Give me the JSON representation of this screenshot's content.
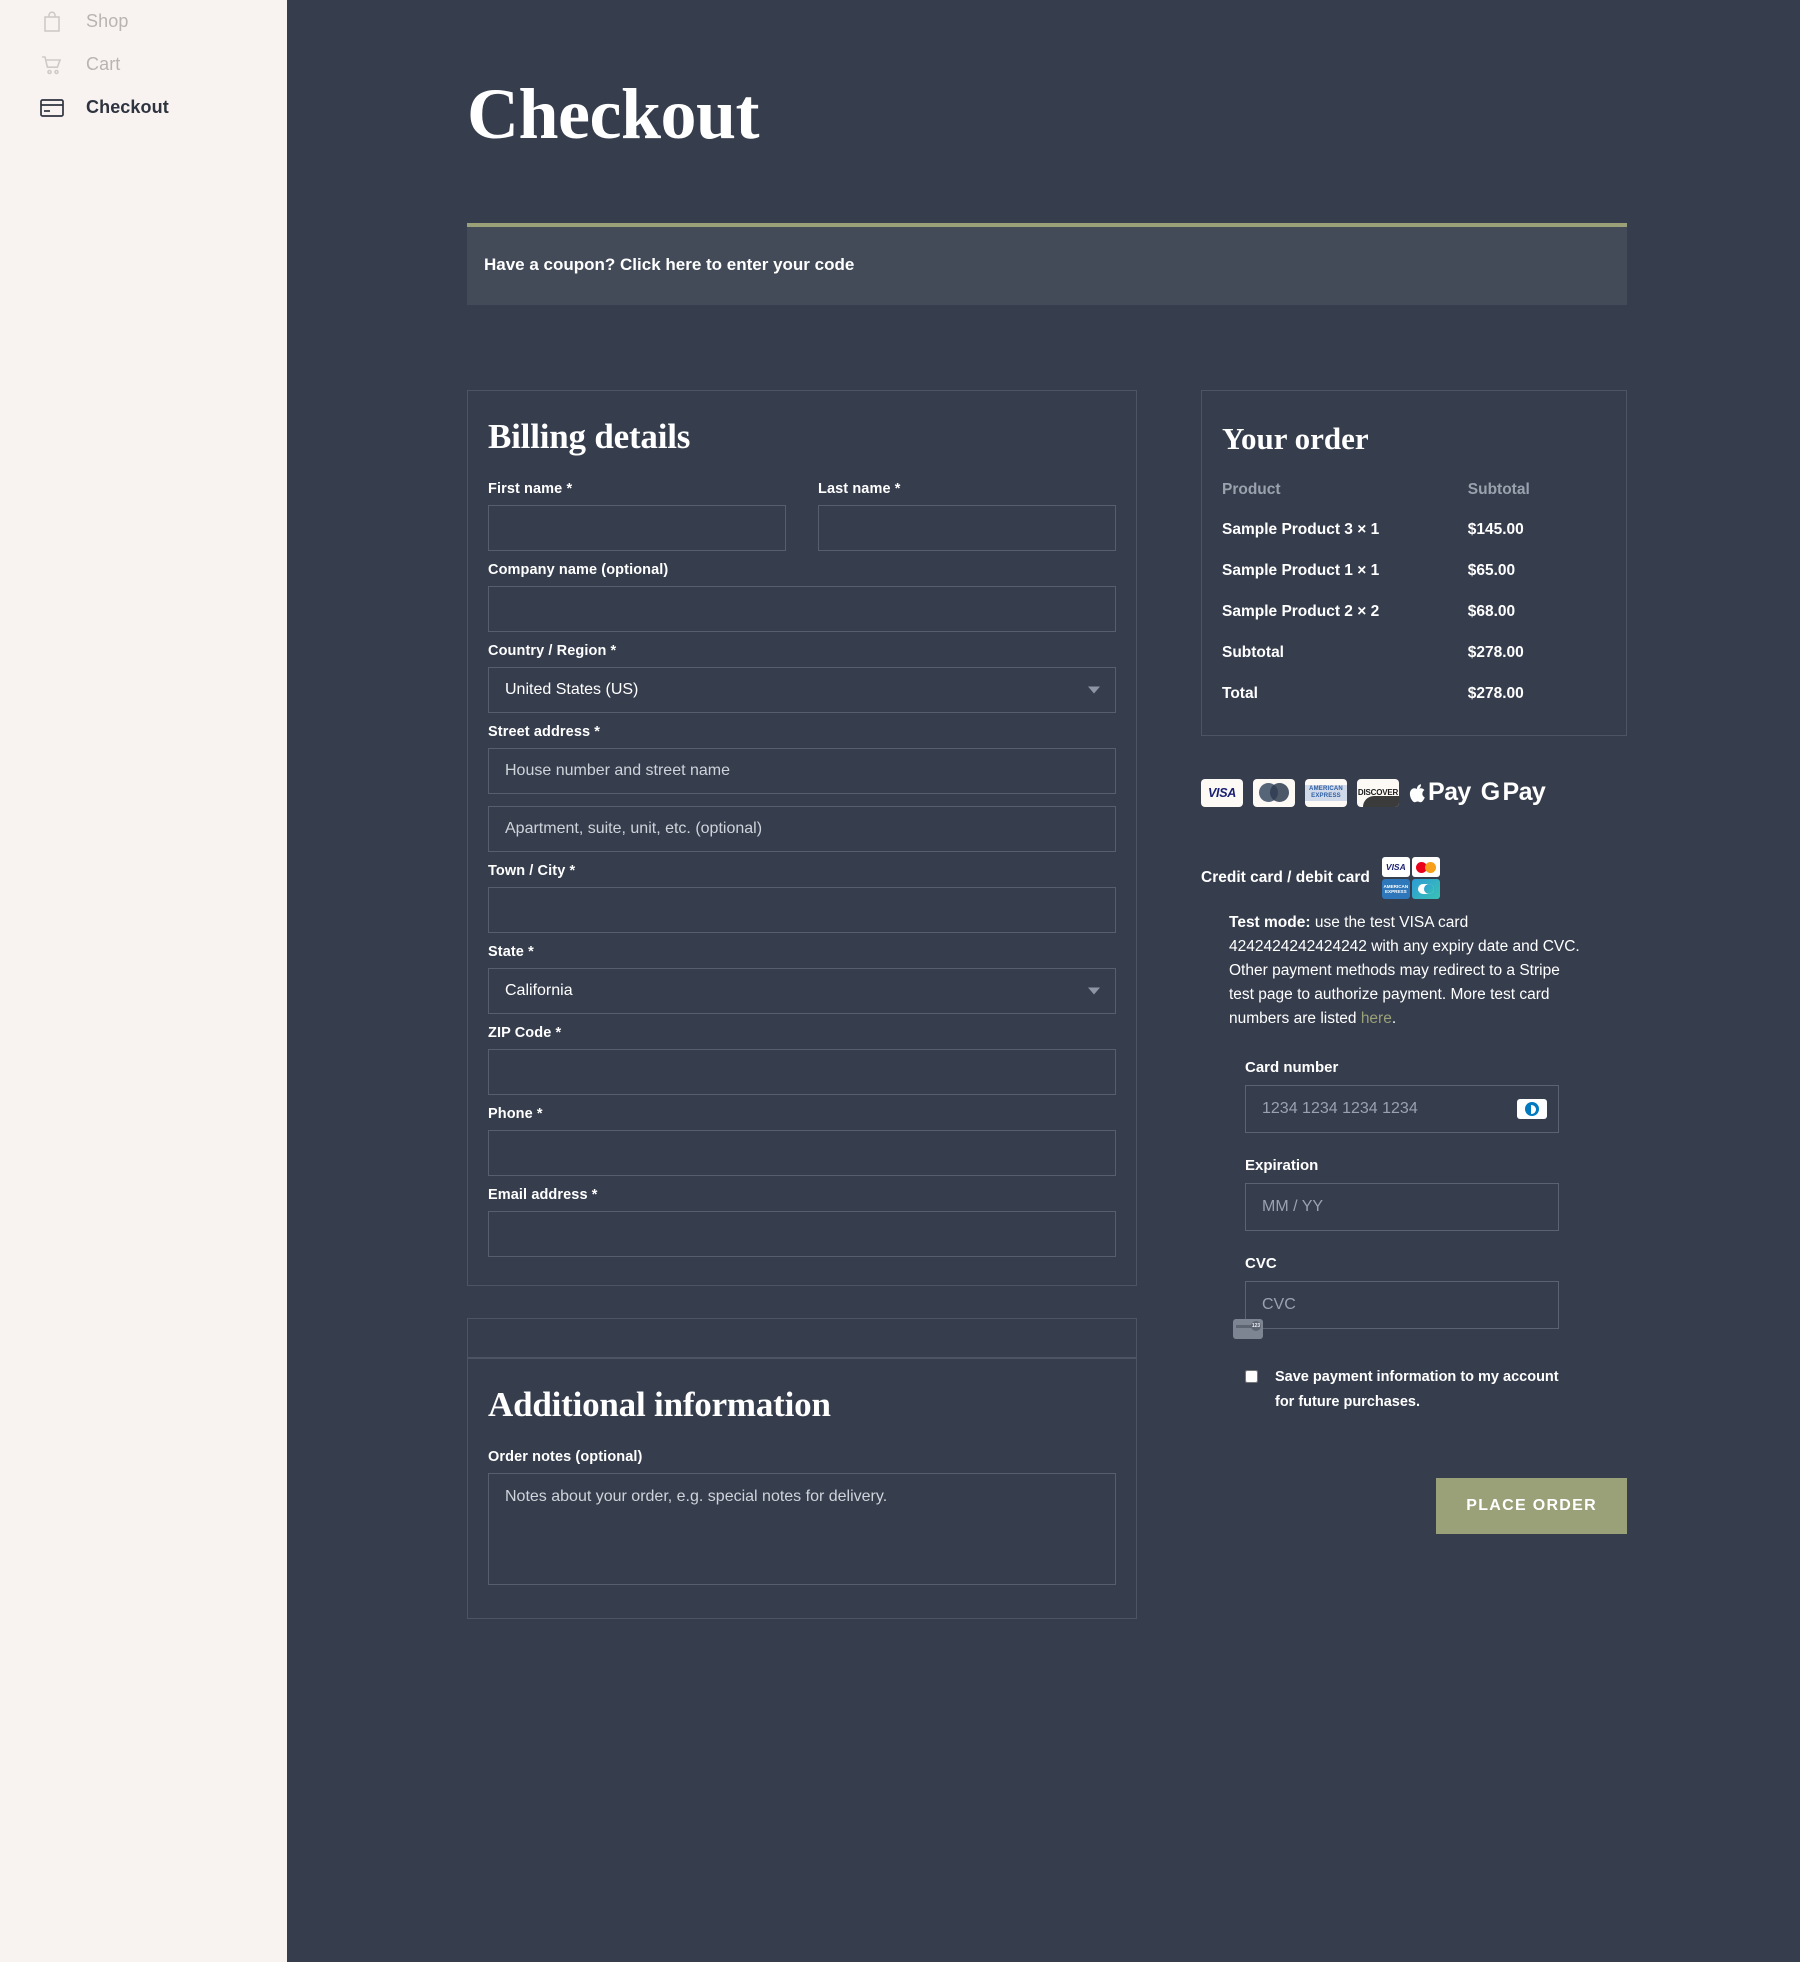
{
  "sidebar": {
    "items": [
      {
        "label": "Shop",
        "icon": "shopping-bag-icon",
        "state": "muted"
      },
      {
        "label": "Cart",
        "icon": "shopping-cart-icon",
        "state": "muted"
      },
      {
        "label": "Checkout",
        "icon": "credit-card-icon",
        "state": "active"
      }
    ]
  },
  "page": {
    "title": "Checkout"
  },
  "coupon": {
    "text": "Have a coupon? Click here to enter your code",
    "accent_color": "#9aa077"
  },
  "billing": {
    "title": "Billing details",
    "fields": {
      "first_name": {
        "label": "First name *",
        "value": "",
        "placeholder": ""
      },
      "last_name": {
        "label": "Last name *",
        "value": "",
        "placeholder": ""
      },
      "company": {
        "label": "Company name (optional)",
        "value": "",
        "placeholder": ""
      },
      "country": {
        "label": "Country / Region *",
        "value": "United States (US)"
      },
      "street": {
        "label": "Street address *",
        "line1_placeholder": "House number and street name",
        "line2_placeholder": "Apartment, suite, unit, etc. (optional)",
        "line1_value": "",
        "line2_value": ""
      },
      "city": {
        "label": "Town / City *",
        "value": "",
        "placeholder": ""
      },
      "state": {
        "label": "State *",
        "value": "California"
      },
      "zip": {
        "label": "ZIP Code *",
        "value": "",
        "placeholder": ""
      },
      "phone": {
        "label": "Phone *",
        "value": "",
        "placeholder": ""
      },
      "email": {
        "label": "Email address *",
        "value": "",
        "placeholder": ""
      }
    }
  },
  "additional": {
    "title": "Additional information",
    "notes_label": "Order notes (optional)",
    "notes_placeholder": "Notes about your order, e.g. special notes for delivery.",
    "notes_value": ""
  },
  "order": {
    "title": "Your order",
    "headers": {
      "product": "Product",
      "subtotal": "Subtotal"
    },
    "items": [
      {
        "name": "Sample Product 3",
        "qty": "× 1",
        "subtotal": "$145.00"
      },
      {
        "name": "Sample Product 1",
        "qty": "× 1",
        "subtotal": "$65.00"
      },
      {
        "name": "Sample Product 2",
        "qty": "× 2",
        "subtotal": "$68.00"
      }
    ],
    "subtotal": {
      "label": "Subtotal",
      "value": "$278.00"
    },
    "total": {
      "label": "Total",
      "value": "$278.00"
    }
  },
  "payment_logos": [
    {
      "name": "visa-logo",
      "text": "VISA"
    },
    {
      "name": "mastercard-logo",
      "text": "mastercard"
    },
    {
      "name": "amex-logo",
      "text": "AMERICAN EXPRESS"
    },
    {
      "name": "discover-logo",
      "text": "DISCOVER"
    },
    {
      "name": "apple-pay-logo",
      "text": "Pay"
    },
    {
      "name": "google-pay-logo",
      "text": "Pay"
    }
  ],
  "payment": {
    "method_label": "Credit card / debit card",
    "brand_icons": [
      "visa-icon",
      "mastercard-icon",
      "amex-icon",
      "cb-icon"
    ],
    "test_mode_prefix": "Test mode:",
    "test_mode_body": " use the test VISA card 4242424242424242 with any expiry date and CVC. Other payment methods may redirect to a Stripe test page to authorize payment. More test card numbers are listed ",
    "test_mode_link": "here",
    "test_mode_suffix": ".",
    "card_number": {
      "label": "Card number",
      "placeholder": "1234 1234 1234 1234",
      "value": ""
    },
    "expiration": {
      "label": "Expiration",
      "placeholder": "MM / YY",
      "value": ""
    },
    "cvc": {
      "label": "CVC",
      "placeholder": "CVC",
      "value": ""
    },
    "save_label": "Save payment information to my account for future purchases.",
    "save_checked": false
  },
  "actions": {
    "place_order": "PLACE ORDER",
    "place_order_color": "#9aa077"
  },
  "theme": {
    "background": "#363d4d",
    "sidebar_background": "#f8f3f1",
    "accent": "#9aa077",
    "coupon_background": "#434a58"
  }
}
